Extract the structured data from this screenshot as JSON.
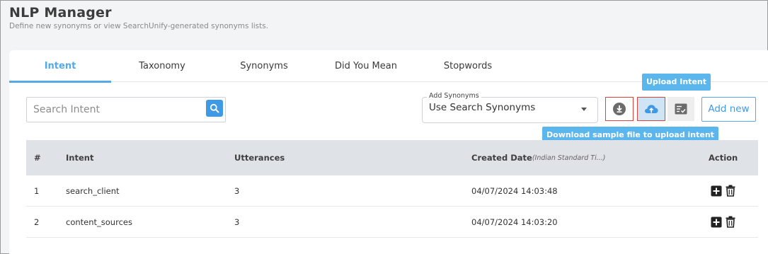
{
  "header": {
    "title": "NLP Manager",
    "subtitle": "Define new synonyms or view SearchUnify-generated synonyms lists."
  },
  "tabs": [
    {
      "label": "Intent",
      "active": true
    },
    {
      "label": "Taxonomy"
    },
    {
      "label": "Synonyms"
    },
    {
      "label": "Did You Mean"
    },
    {
      "label": "Stopwords"
    }
  ],
  "search": {
    "placeholder": "Search Intent",
    "value": ""
  },
  "synonyms_select": {
    "legend": "Add Synonyms",
    "value": "Use Search Synonyms"
  },
  "toolbar": {
    "download_icon": "download-icon",
    "upload_icon": "cloud-upload-icon",
    "sample_icon": "checklist-icon",
    "add_new_label": "Add new"
  },
  "tooltips": {
    "upload": "Upload Intent",
    "sample": "Download sample file to upload intent"
  },
  "table": {
    "headers": {
      "num": "#",
      "intent": "Intent",
      "utterances": "Utterances",
      "created": "Created Date",
      "created_note": "(Indian Standard Ti...)",
      "action": "Action"
    },
    "rows": [
      {
        "num": "1",
        "intent": "search_client",
        "utterances": "3",
        "created": "04/07/2024 14:03:48"
      },
      {
        "num": "2",
        "intent": "content_sources",
        "utterances": "3",
        "created": "04/07/2024 14:03:20"
      }
    ]
  },
  "colors": {
    "accent": "#55a9e6",
    "highlight_border": "#e0433c",
    "tooltip_bg": "#5ab6ec"
  }
}
